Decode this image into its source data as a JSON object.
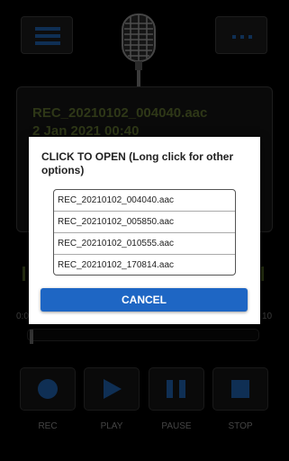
{
  "display": {
    "file_name": "REC_20210102_004040.aac",
    "file_date": "2 Jan 2021 00:40"
  },
  "timeline": {
    "start_label": "0:0",
    "end_label": "10"
  },
  "controls": {
    "rec_label": "REC",
    "play_label": "PLAY",
    "pause_label": "PAUSE",
    "stop_label": "STOP"
  },
  "dialog": {
    "title": "CLICK TO OPEN (Long click for other options)",
    "files": [
      "REC_20210102_004040.aac",
      "REC_20210102_005850.aac",
      "REC_20210102_010555.aac",
      "REC_20210102_170814.aac"
    ],
    "cancel_label": "CANCEL"
  },
  "icons": {
    "menu": "menu-icon",
    "more": "more-icon",
    "microphone": "microphone-icon",
    "record": "record-icon",
    "play": "play-icon",
    "pause": "pause-icon",
    "stop": "stop-icon"
  },
  "colors": {
    "accent_blue": "#1f5fa8",
    "text_olive": "#5d6e2f",
    "cancel_button": "#1e66c4"
  }
}
